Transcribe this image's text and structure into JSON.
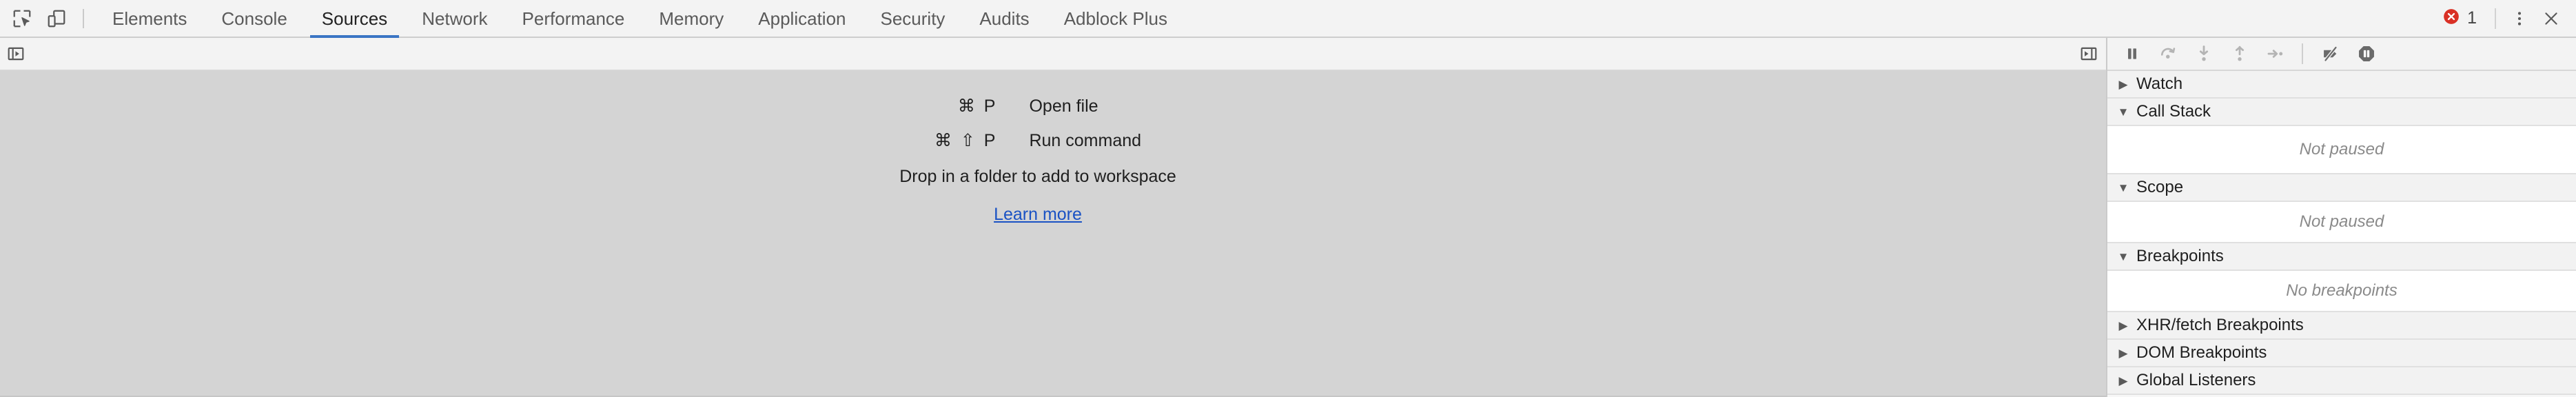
{
  "toolbar": {
    "inspect_icon": "inspect-element-icon",
    "device_icon": "device-toolbar-icon",
    "tabs": [
      {
        "label": "Elements",
        "active": false
      },
      {
        "label": "Console",
        "active": false
      },
      {
        "label": "Sources",
        "active": true
      },
      {
        "label": "Network",
        "active": false
      },
      {
        "label": "Performance",
        "active": false
      },
      {
        "label": "Memory",
        "active": false
      },
      {
        "label": "Application",
        "active": false
      },
      {
        "label": "Security",
        "active": false
      },
      {
        "label": "Audits",
        "active": false
      },
      {
        "label": "Adblock Plus",
        "active": false
      }
    ],
    "error_count": "1",
    "more_label": "⋮",
    "close_label": "×",
    "accent_color": "#3a75c4",
    "error_color": "#d93025"
  },
  "editor": {
    "show_navigator_tooltip": "Show navigator",
    "show_debugger_tooltip": "Show debugger",
    "shortcuts": [
      {
        "keys": "⌘ P",
        "label": "Open file"
      },
      {
        "keys": "⌘ ⇧ P",
        "label": "Run command"
      }
    ],
    "drop_hint": "Drop in a folder to add to workspace",
    "learn_more": "Learn more",
    "link_color": "#1a52c4",
    "background_color": "#d4d4d4"
  },
  "debugger": {
    "controls": [
      {
        "name": "resume-script-execution",
        "icon": "pause-icon"
      },
      {
        "name": "step-over-next-function-call",
        "icon": "step-over-icon"
      },
      {
        "name": "step-into-next-function-call",
        "icon": "step-into-icon"
      },
      {
        "name": "step-out-of-current-function",
        "icon": "step-out-icon"
      },
      {
        "name": "step",
        "icon": "step-icon"
      },
      {
        "name": "deactivate-breakpoints",
        "icon": "deactivate-breakpoints-icon"
      },
      {
        "name": "pause-on-exceptions",
        "icon": "pause-on-exceptions-icon"
      }
    ],
    "panes": [
      {
        "title": "Watch",
        "expanded": false,
        "body": null
      },
      {
        "title": "Call Stack",
        "expanded": true,
        "body": "Not paused"
      },
      {
        "title": "Scope",
        "expanded": true,
        "body": "Not paused"
      },
      {
        "title": "Breakpoints",
        "expanded": true,
        "body": "No breakpoints"
      },
      {
        "title": "XHR/fetch Breakpoints",
        "expanded": false,
        "body": null
      },
      {
        "title": "DOM Breakpoints",
        "expanded": false,
        "body": null
      },
      {
        "title": "Global Listeners",
        "expanded": false,
        "body": null
      }
    ],
    "triangle_collapsed": "▶",
    "triangle_expanded": "▼"
  }
}
